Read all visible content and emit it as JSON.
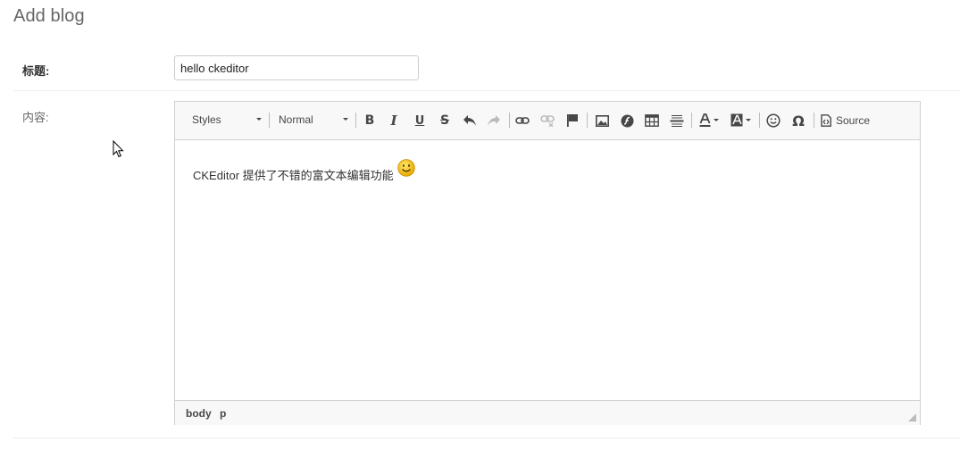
{
  "page": {
    "title": "Add blog"
  },
  "form": {
    "title_label": "标题:",
    "title_value": "hello ckeditor",
    "content_label": "内容:"
  },
  "editor": {
    "styles_combo": "Styles",
    "format_combo": "Normal",
    "source_label": "Source",
    "content_text": "CKEditor 提供了不错的富文本编辑功能",
    "path": [
      "body",
      "p"
    ],
    "icons": [
      "bold-icon",
      "italic-icon",
      "underline-icon",
      "strikethrough-icon",
      "undo-icon",
      "redo-icon",
      "link-icon",
      "unlink-icon",
      "anchor-flag-icon",
      "image-icon",
      "flash-icon",
      "table-icon",
      "horizontal-rule-icon",
      "text-color-icon",
      "background-color-icon",
      "smiley-icon",
      "special-char-icon",
      "source-icon"
    ]
  },
  "colors": {
    "toolbar_bg": "#f8f8f8",
    "border": "#d1d1d1",
    "icon": "#474747",
    "disabled_icon": "#bbbbbb"
  }
}
